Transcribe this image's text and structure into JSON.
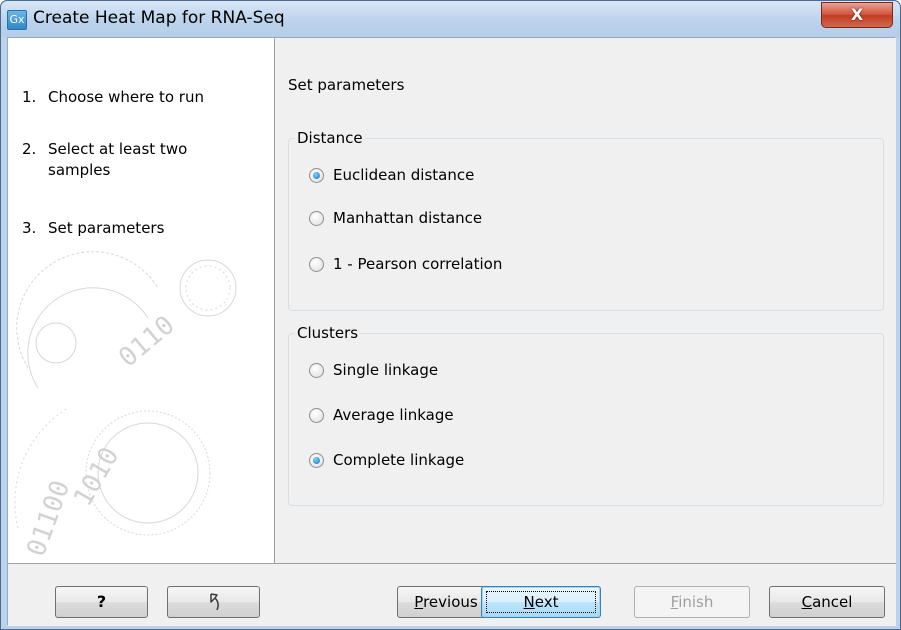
{
  "window": {
    "app_icon": "Gx",
    "title": "Create Heat Map for RNA-Seq",
    "close_glyph": "X"
  },
  "steps": [
    {
      "number": "1.",
      "label": "Choose where to run"
    },
    {
      "number": "2.",
      "label": "Select at least two samples"
    },
    {
      "number": "3.",
      "label": "Set parameters"
    }
  ],
  "main": {
    "section_title": "Set parameters",
    "distance": {
      "legend": "Distance",
      "options": [
        {
          "label": "Euclidean distance",
          "checked": true
        },
        {
          "label": "Manhattan distance",
          "checked": false
        },
        {
          "label": "1 - Pearson correlation",
          "checked": false
        }
      ]
    },
    "clusters": {
      "legend": "Clusters",
      "options": [
        {
          "label": "Single linkage",
          "checked": false
        },
        {
          "label": "Average linkage",
          "checked": false
        },
        {
          "label": "Complete linkage",
          "checked": true
        }
      ]
    }
  },
  "buttons": {
    "help": "?",
    "undo_icon": "reset-arrow-icon",
    "previous": {
      "mnemonic": "P",
      "rest": "revious"
    },
    "next": {
      "mnemonic": "N",
      "rest": "ext"
    },
    "finish": {
      "mnemonic": "F",
      "rest": "inish",
      "disabled": true
    },
    "cancel": {
      "mnemonic": "C",
      "rest": "ancel"
    }
  },
  "colors": {
    "titlebar": "#bcd3ec",
    "close_button": "#c23b21",
    "focused_button": "#bee6fd",
    "radio_checked": "#1b6bbd"
  }
}
